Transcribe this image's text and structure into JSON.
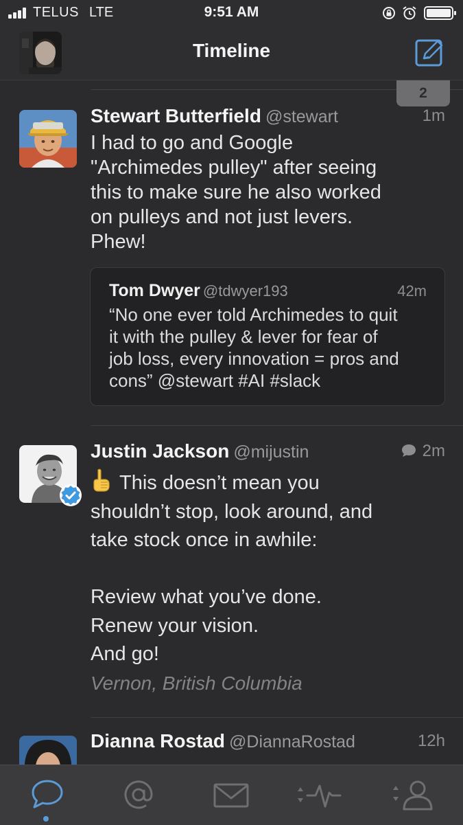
{
  "status_bar": {
    "carrier": "TELUS",
    "network": "LTE",
    "time": "9:51 AM"
  },
  "nav": {
    "title": "Timeline"
  },
  "new_tweets_count": "2",
  "tweets": [
    {
      "name": "Stewart Butterfield",
      "handle": "@stewart",
      "time": "1m",
      "body_lines": [
        "I had to go and Google",
        "\"Archimedes pulley\" after seeing",
        "this to make sure he also worked",
        "on pulleys and not just levers.",
        "Phew!"
      ],
      "quote": {
        "name": "Tom Dwyer",
        "handle": "@tdwyer193",
        "time": "42m",
        "body_lines": [
          "“No one ever told Archimedes to quit",
          "it with the pulley & lever for fear of",
          "job loss, every innovation = pros and",
          "cons” @stewart #AI #slack"
        ]
      }
    },
    {
      "name": "Justin Jackson",
      "handle": "@mijustin",
      "time": "2m",
      "verified": true,
      "emoji": "☝️",
      "body_lines": [
        "This doesn’t mean you",
        "shouldn’t stop, look around, and",
        "take stock once in awhile:",
        "",
        "Review what you’ve done.",
        "Renew your vision.",
        "And go!"
      ],
      "location": "Vernon, British Columbia"
    },
    {
      "name": "Dianna Rostad",
      "handle": "@DiannaRostad",
      "time": "12h"
    }
  ],
  "tabs": [
    {
      "icon": "timeline-bubble-icon",
      "active": true
    },
    {
      "icon": "mentions-at-icon",
      "active": false
    },
    {
      "icon": "messages-envelope-icon",
      "active": false
    },
    {
      "icon": "activity-pulse-icon",
      "active": false
    },
    {
      "icon": "profile-person-icon",
      "active": false
    }
  ],
  "colors": {
    "background": "#2b2b2d",
    "accent": "#5a9bd8",
    "tab_bar": "#3b3b3e"
  }
}
